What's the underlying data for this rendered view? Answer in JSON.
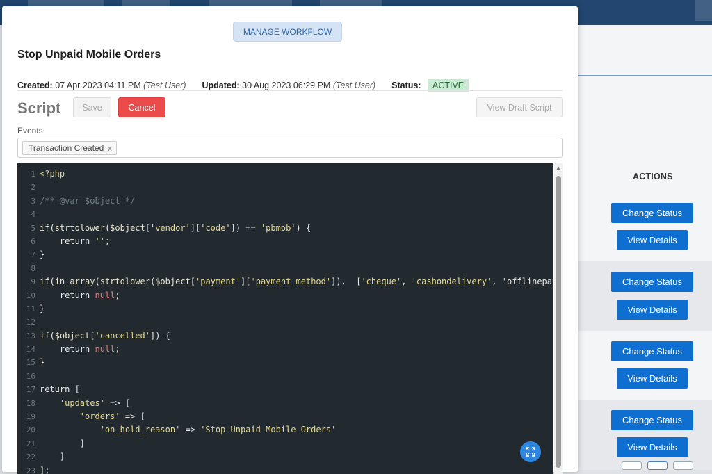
{
  "background": {
    "actions_header": "ACTIONS",
    "rows": [
      {
        "change_status": "Change Status",
        "view_details": "View Details"
      },
      {
        "change_status": "Change Status",
        "view_details": "View Details"
      },
      {
        "change_status": "Change Status",
        "view_details": "View Details"
      },
      {
        "change_status": "Change Status",
        "view_details": "View Details"
      }
    ],
    "topbar_color": "#22466f",
    "button_color": "#0e6fd1"
  },
  "modal": {
    "workflow_button": "MANAGE WORKFLOW",
    "title": "Stop Unpaid Mobile Orders",
    "meta": {
      "created_label": "Created:",
      "created_value": "07 Apr 2023 04:11 PM",
      "created_by": "(Test User)",
      "updated_label": "Updated:",
      "updated_value": "30 Aug 2023 06:29 PM",
      "updated_by": "(Test User)",
      "status_label": "Status:",
      "status_value": "ACTIVE"
    },
    "script_heading": "Script",
    "save_label": "Save",
    "cancel_label": "Cancel",
    "view_draft_label": "View Draft Script",
    "events_label": "Events:",
    "event_tags": [
      {
        "label": "Transaction Created",
        "remove": "x"
      }
    ],
    "cancel_color": "#ec4b4b",
    "status_color": "#c9ead3"
  },
  "editor": {
    "code_lines": [
      "<?php",
      "",
      "/** @var $object */",
      "",
      "if(strtolower($object['vendor']['code']) == 'pbmob') {",
      "    return '';",
      "}",
      "",
      "if(in_array(strtolower($object['payment']['payment_method']),  ['cheque', 'cashondelivery', 'offlinepayme",
      "    return null;",
      "}",
      "",
      "if($object['cancelled']) {",
      "    return null;",
      "}",
      "",
      "return [",
      "    'updates' => [",
      "        'orders' => [",
      "            'on_hold_reason' => 'Stop Unpaid Mobile Orders'",
      "        ]",
      "    ]",
      "];"
    ],
    "expand_icon": "expand-icon"
  }
}
